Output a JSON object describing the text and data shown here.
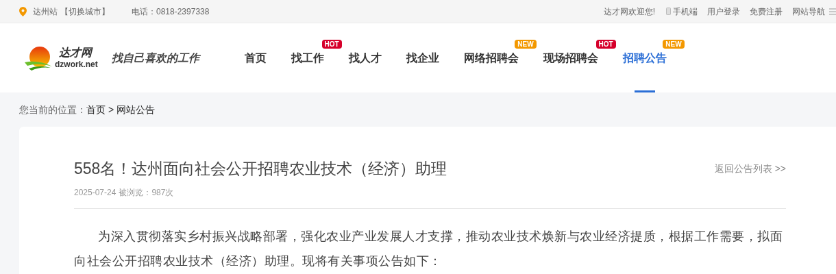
{
  "top_bar": {
    "station": "达州站",
    "switch_city": "【切换城市】",
    "phone": "电话：0818-2397338",
    "welcome": "达才网欢迎您!",
    "links": [
      "手机端",
      "用户登录",
      "免费注册",
      "网站导航"
    ]
  },
  "logo": {
    "name": "达才网",
    "domain": "dzwork.net",
    "slogan": "找自己喜欢的工作"
  },
  "nav": [
    {
      "label": "首页",
      "selected": false
    },
    {
      "label": "找工作",
      "selected": false,
      "badge": {
        "kind": "hot",
        "text": "HOT"
      }
    },
    {
      "label": "找人才",
      "selected": false
    },
    {
      "label": "找企业",
      "selected": false
    },
    {
      "label": "网络招聘会",
      "selected": false,
      "badge": {
        "kind": "new",
        "text": "NEW"
      }
    },
    {
      "label": "现场招聘会",
      "selected": false,
      "badge": {
        "kind": "hot",
        "text": "HOT"
      }
    },
    {
      "label": "招聘公告",
      "selected": true,
      "badge": {
        "kind": "new",
        "text": "NEW"
      }
    }
  ],
  "breadcrumb": {
    "prefix": "您当前的位置：",
    "items": [
      "首页",
      "网站公告"
    ],
    "separator": ">"
  },
  "article": {
    "title": "558名！达州面向社会公开招聘农业技术（经济）助理",
    "back_link": "返回公告列表 >>",
    "date": "2025-07-24",
    "views": "被浏览：987次",
    "paragraphs": [
      "为深入贯彻落实乡村振兴战略部署，强化农业产业发展人才支撑，推动农业技术焕新与农业经济提质，根据工作需要，拟面向社会公开招聘农业技术（经济）助理。现将有关事项公告如下："
    ]
  }
}
